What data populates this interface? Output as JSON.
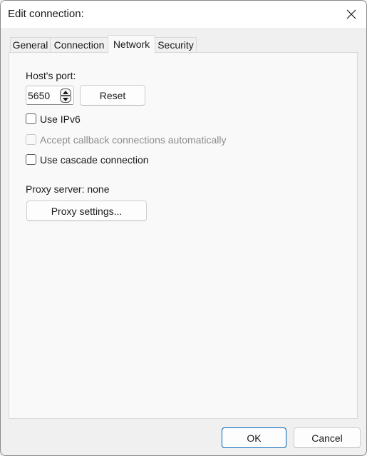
{
  "window": {
    "title": "Edit connection:",
    "close_icon": "close-icon"
  },
  "tabs": [
    {
      "label": "General",
      "active": false
    },
    {
      "label": "Connection",
      "active": false
    },
    {
      "label": "Network",
      "active": true
    },
    {
      "label": "Security",
      "active": false
    }
  ],
  "network": {
    "host_port_label": "Host's port:",
    "host_port_value": "5650",
    "reset_label": "Reset",
    "checkboxes": [
      {
        "label": "Use IPv6",
        "checked": false,
        "enabled": true
      },
      {
        "label": "Accept callback connections automatically",
        "checked": false,
        "enabled": false
      },
      {
        "label": "Use cascade connection",
        "checked": false,
        "enabled": true
      }
    ],
    "proxy_label": "Proxy server: none",
    "proxy_settings_label": "Proxy settings..."
  },
  "footer": {
    "ok_label": "OK",
    "cancel_label": "Cancel"
  }
}
